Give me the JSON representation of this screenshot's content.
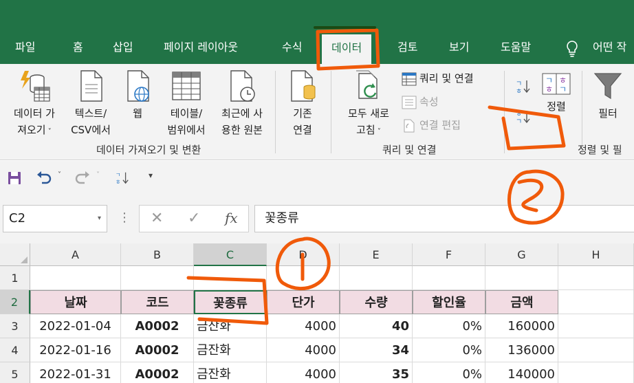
{
  "ribbon_tabs": {
    "file": "파일",
    "home": "홈",
    "insert": "삽입",
    "page_layout": "페이지 레이아웃",
    "formulas": "수식",
    "data": "데이터",
    "review": "검토",
    "view": "보기",
    "help": "도움말",
    "tell_me": "어떤 작"
  },
  "ribbon": {
    "get_data": {
      "line1": "데이터 가",
      "line2": "져오기"
    },
    "from_text_csv": {
      "line1": "텍스트/",
      "line2": "CSV에서"
    },
    "from_web": {
      "line1": "웹"
    },
    "from_table": {
      "line1": "테이블/",
      "line2": "범위에서"
    },
    "recent_sources": {
      "line1": "최근에 사",
      "line2": "용한 원본"
    },
    "existing_connections": {
      "line1": "기존",
      "line2": "연결"
    },
    "group_get_transform": "데이터 가져오기 및 변환",
    "refresh_all": {
      "line1": "모두 새로",
      "line2": "고침"
    },
    "queries_connections": "쿼리 및 연결",
    "properties": "속성",
    "edit_links": "연결 편집",
    "group_queries": "쿼리 및 연결",
    "sort_label": "정렬",
    "filter_label": "필터",
    "group_sort_filter": "정렬 및 필"
  },
  "formula_bar": {
    "name_box": "C2",
    "fx": "fx",
    "content": "꽃종류"
  },
  "columns": [
    "A",
    "B",
    "C",
    "D",
    "E",
    "F",
    "G",
    "H"
  ],
  "rows": [
    "1",
    "2",
    "3",
    "4",
    "5"
  ],
  "table": {
    "headers": [
      "날짜",
      "코드",
      "꽃종류",
      "단가",
      "수량",
      "할인율",
      "금액"
    ],
    "data": [
      [
        "2022-01-04",
        "A0002",
        "금잔화",
        "4000",
        "40",
        "0%",
        "160000"
      ],
      [
        "2022-01-16",
        "A0002",
        "금잔화",
        "4000",
        "34",
        "0%",
        "136000"
      ],
      [
        "2022-01-31",
        "A0002",
        "금잔화",
        "4000",
        "35",
        "0%",
        "140000"
      ]
    ]
  },
  "colors": {
    "excel_green": "#217346",
    "header_fill": "#f2dce3",
    "annotation": "#f05a0a"
  }
}
